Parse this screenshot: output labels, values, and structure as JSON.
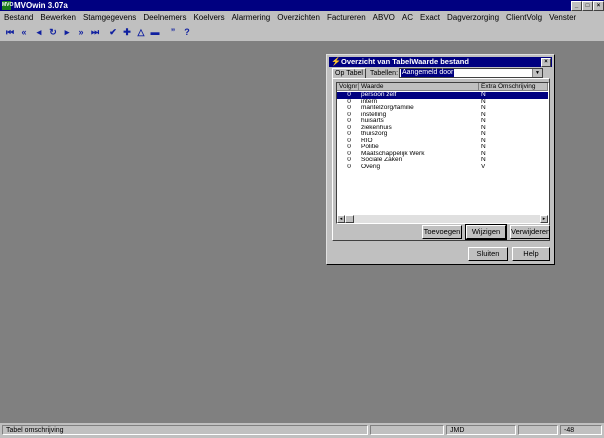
{
  "app": {
    "title": "MVOwin 3.07a",
    "icon": "app-icon"
  },
  "window_controls": {
    "minimize": "_",
    "maximize": "□",
    "close": "×"
  },
  "menu": [
    "Bestand",
    "Bewerken",
    "Stamgegevens",
    "Deelnemers",
    "Koelvers",
    "Alarmering",
    "Overzichten",
    "Factureren",
    "ABVO",
    "AC",
    "Exact",
    "Dagverzorging",
    "ClientVolg",
    "Venster"
  ],
  "toolbar": {
    "first": "⏮",
    "prev_page": "«",
    "prev": "◂",
    "refresh": "↻",
    "next": "▸",
    "next_page": "»",
    "last": "⏭",
    "confirm": "✔",
    "add": "✚",
    "up": "△",
    "remove": "▬",
    "quote": "”",
    "help": "?"
  },
  "dialog": {
    "title": "Overzicht van TabelWaarde bestand",
    "icon": "⚡",
    "close": "×",
    "tab_label": "Op Tabel",
    "tables_label": "Tabellen:",
    "tables_value": "Aangemeld door",
    "combo_arrow": "▼",
    "columns": [
      "Volgnr",
      "Waarde",
      "Extra Omschrijving"
    ],
    "rows": [
      [
        "0",
        "persoon zelf",
        "N"
      ],
      [
        "0",
        "intern",
        "N"
      ],
      [
        "0",
        "mantelzorg/familie",
        "N"
      ],
      [
        "0",
        "instelling",
        "N"
      ],
      [
        "0",
        "huisarts",
        "N"
      ],
      [
        "0",
        "ziekenhuis",
        "N"
      ],
      [
        "0",
        "thuiszorg",
        "N"
      ],
      [
        "0",
        "RIO",
        "N"
      ],
      [
        "0",
        "Politie",
        "N"
      ],
      [
        "0",
        "Maatschappelijk Werk",
        "N"
      ],
      [
        "0",
        "Sociale Zaken",
        "N"
      ],
      [
        "0",
        "Overig",
        "V"
      ]
    ],
    "selected_row": 0,
    "scroll_left": "◂",
    "scroll_right": "▸",
    "buttons": {
      "toevoegen": "Toevoegen",
      "wijzigen": "Wijzigen",
      "verwijderen": "Verwijderen",
      "sluiten": "Sluiten",
      "help": "Help"
    }
  },
  "status": {
    "description": "Tabel omschrijving",
    "user": "JMD",
    "code": "-48"
  }
}
